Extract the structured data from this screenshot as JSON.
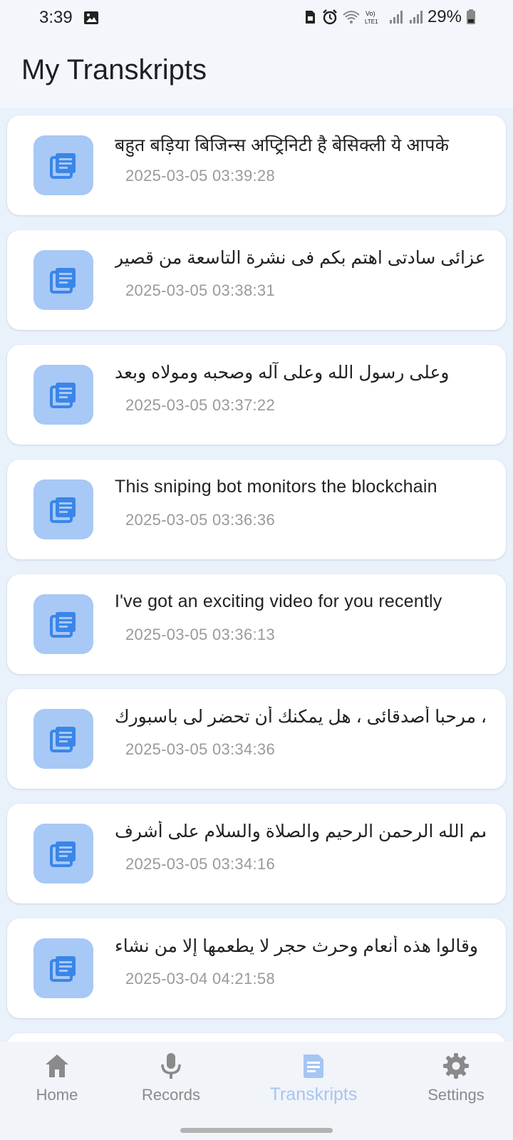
{
  "status_bar": {
    "time": "3:39",
    "battery": "29%",
    "icons": [
      "image-icon",
      "sim-icon",
      "alarm-icon",
      "wifi-icon",
      "volte-icon",
      "signal-icon",
      "signal-icon",
      "battery-icon"
    ]
  },
  "header": {
    "title": "My Transkripts"
  },
  "transcripts": [
    {
      "title": "बहुत बड़िया बिजिन्स अप्ट्रिनिटी है बेसिक्ली ये आपके",
      "date": "2025-03-05 03:39:28"
    },
    {
      "title": "اعزائی سادتی اهتم بكم فی نشرة التاسعة من قصير",
      "date": "2025-03-05 03:38:31"
    },
    {
      "title": "وعلى رسول الله وعلى آله وصحبه ومولاه وبعد",
      "date": "2025-03-05 03:37:22"
    },
    {
      "title": "This sniping bot monitors the blockchain",
      "date": "2025-03-05 03:36:36"
    },
    {
      "title": "I've got an exciting video for you recently",
      "date": "2025-03-05 03:36:13"
    },
    {
      "title": "مرحبا أصدقائی ، هل یمکنك أن تحضر لی باسبورك ،",
      "date": "2025-03-05 03:34:36"
    },
    {
      "title": "بسم الله الرحمن الرحيم والصلاة والسلام على أشرف",
      "date": "2025-03-05 03:34:16"
    },
    {
      "title": "وقالوا هذه أنعام وحرث حجر لا يطعمها إلا من نشاء",
      "date": "2025-03-04 04:21:58"
    }
  ],
  "nav": {
    "items": [
      {
        "label": "Home",
        "icon": "home-icon"
      },
      {
        "label": "Records",
        "icon": "microphone-icon"
      },
      {
        "label": "Transkripts",
        "icon": "document-icon",
        "active": true
      },
      {
        "label": "Settings",
        "icon": "gear-icon"
      }
    ]
  },
  "colors": {
    "accent": "#a8c8f5",
    "accent_icon": "#3a86e8",
    "background": "#e9f1fb"
  }
}
